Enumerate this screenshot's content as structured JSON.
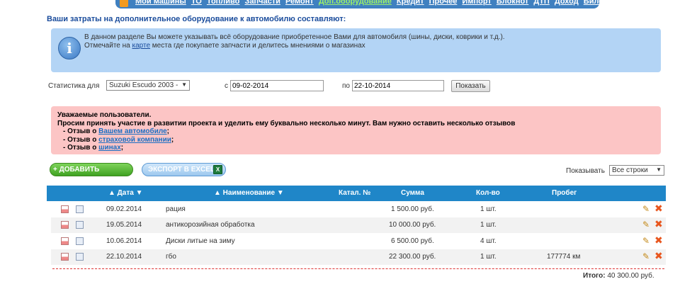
{
  "nav": {
    "items": [
      "Мои машины",
      "ТО",
      "Топливо",
      "Запчасти",
      "Ремонт",
      "Доп.оборудование",
      "Кредит",
      "Прочее",
      "Импорт",
      "Блокнот",
      "ДТП",
      "Доход",
      "Билеты ПДД"
    ],
    "active_index": 5
  },
  "page_title": "Ваши затраты на дополнительное оборудование к автомобилю составляют:",
  "info": {
    "line1": "В данном разделе Вы можете указывать всё оборудование приобретенное Вами для автомобиля (шины, диски, коврики и т.д.).",
    "line2_pre": "Отмечайте на ",
    "line2_link": "карте",
    "line2_post": " места где покупаете запчасти и делитесь мнениями о магазинах"
  },
  "filter": {
    "stat_label": "Статистика для",
    "car_value": "Suzuki Escudo 2003 -",
    "from_label": "с",
    "from_value": "09-02-2014",
    "to_label": "по",
    "to_value": "22-10-2014",
    "show_button": "Показать"
  },
  "alert": {
    "line1": "Уважаемые пользователи.",
    "line2": "Просим принять участие в развитии проекта и уделить ему буквально несколько минут. Вам нужно оставить несколько отзывов",
    "items": [
      {
        "pre": "- Отзыв о ",
        "link": "Вашем автомобиле",
        "post": ";"
      },
      {
        "pre": "- Отзыв о ",
        "link": "страховой компании",
        "post": ";"
      },
      {
        "pre": "- Отзыв о ",
        "link": "шинах",
        "post": ";"
      }
    ]
  },
  "actions": {
    "add_label": "+ ДОБАВИТЬ РАСХОДЫ",
    "export_label": "ЭКСПОРТ В EXCEL",
    "show_label": "Показывать",
    "rows_select": "Все строки"
  },
  "table": {
    "headers": {
      "date": "▲ Дата ▼",
      "name": "▲ Наименование ▼",
      "catalog": "Катал. №",
      "sum": "Сумма",
      "qty": "Кол-во",
      "mileage": "Пробег"
    },
    "rows": [
      {
        "date": "09.02.2014",
        "name": "рация",
        "sum": "1 500.00 руб.",
        "qty": "1 шт.",
        "mileage": ""
      },
      {
        "date": "19.05.2014",
        "name": "антикорозийная обработка",
        "sum": "10 000.00 руб.",
        "qty": "1 шт.",
        "mileage": ""
      },
      {
        "date": "10.06.2014",
        "name": "Диски литые на зиму",
        "sum": "6 500.00 руб.",
        "qty": "4 шт.",
        "mileage": ""
      },
      {
        "date": "22.10.2014",
        "name": "гбо",
        "sum": "22 300.00 руб.",
        "qty": "1 шт.",
        "mileage": "177774 км"
      }
    ]
  },
  "total": {
    "label": "Итого:",
    "value": "40 300.00 руб."
  }
}
